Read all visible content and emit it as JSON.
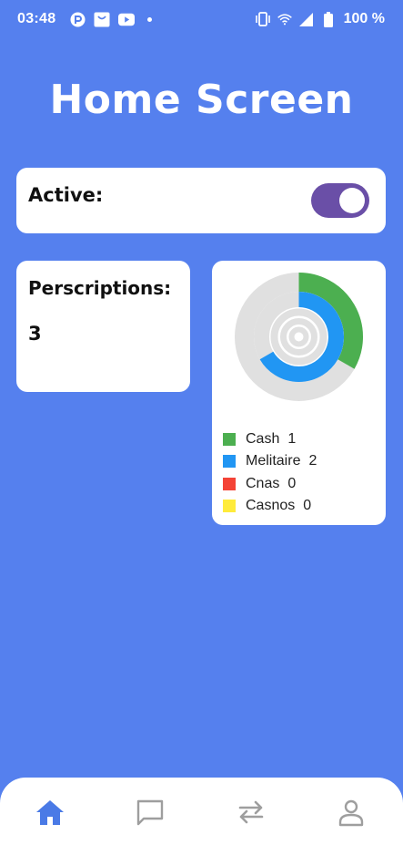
{
  "status_bar": {
    "time": "03:48",
    "battery": "100 %"
  },
  "title": "Home Screen",
  "active_card": {
    "label": "Active:",
    "enabled": true
  },
  "prescriptions_card": {
    "label": "Perscriptions:",
    "count": "3"
  },
  "chart_data": {
    "type": "pie",
    "variant": "concentric-ring",
    "series": [
      {
        "name": "Cash",
        "value": 1,
        "color": "#4caf50"
      },
      {
        "name": "Melitaire",
        "value": 2,
        "color": "#2196f3"
      },
      {
        "name": "Cnas",
        "value": 0,
        "color": "#f44336"
      },
      {
        "name": "Casnos",
        "value": 0,
        "color": "#ffeb3b"
      }
    ],
    "legend": [
      {
        "name": "Cash",
        "value": "1"
      },
      {
        "name": "Melitaire",
        "value": "2"
      },
      {
        "name": "Cnas",
        "value": "0"
      },
      {
        "name": "Casnos",
        "value": "0"
      }
    ],
    "legend_position": "bottom",
    "track_color": "#e0e0e0"
  },
  "bottom_nav": {
    "items": [
      "home-icon",
      "chat-icon",
      "transfer-icon",
      "profile-icon"
    ],
    "active_color": "#4a7ae6",
    "inactive_color": "#9e9e9e"
  }
}
